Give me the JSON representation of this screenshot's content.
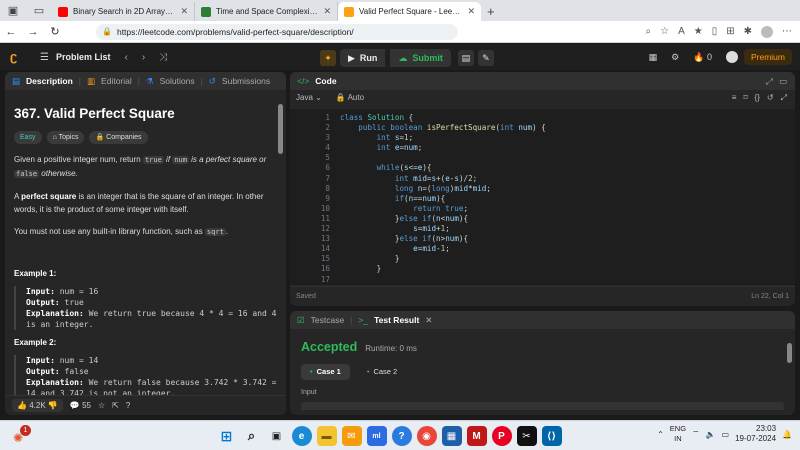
{
  "browser": {
    "tabs": [
      {
        "title": "Binary Search in 2D Arrays - You",
        "color": "#ff0000",
        "active": false
      },
      {
        "title": "Time and Space Complexity Anal",
        "color": "#2e7d32",
        "active": false
      },
      {
        "title": "Valid Perfect Square - LeetCode",
        "color": "#ffa116",
        "active": true
      }
    ],
    "url": "https://leetcode.com/problems/valid-perfect-square/description/"
  },
  "lcnav": {
    "problem_list": "Problem List",
    "run": "Run",
    "submit": "Submit",
    "streak": "0",
    "premium": "Premium"
  },
  "desc": {
    "tabs": [
      "Description",
      "Editorial",
      "Solutions",
      "Submissions"
    ],
    "title": "367. Valid Perfect Square",
    "tags": [
      "Easy",
      "Topics",
      "Companies"
    ],
    "p1_a": "Given a positive integer num, return ",
    "p1_true": "true",
    "p1_b": " if ",
    "p1_num": "num",
    "p1_c": " is a perfect square or",
    "p1_false": "false",
    "p1_d": " otherwise.",
    "p2_a": "A ",
    "p2_bold": "perfect square",
    "p2_b": " is an integer that is the square of an integer. In other words, it is the product of some integer with itself.",
    "p3_a": "You must not use any built-in library function, such as ",
    "p3_code": "sqrt",
    "p3_b": ".",
    "ex1_title": "Example 1:",
    "ex1_input_label": "Input:",
    "ex1_input": " num = 16",
    "ex1_output_label": "Output:",
    "ex1_output": " true",
    "ex1_expl_label": "Explanation:",
    "ex1_expl": " We return true because 4 * 4 = 16 and 4 is an integer.",
    "ex2_title": "Example 2:",
    "ex2_input_label": "Input:",
    "ex2_input": " num = 14",
    "ex2_output_label": "Output:",
    "ex2_output": " false",
    "ex2_expl_label": "Explanation:",
    "ex2_expl": " We return false because 3.742 * 3.742 = 14 and 3.742 is not an integer.",
    "likes": "4.2K",
    "comments": "55"
  },
  "code": {
    "tab": "Code",
    "language": "Java",
    "mode": "Auto",
    "status": "Saved",
    "cursor": "Ln 22, Col 1",
    "lines": [
      [
        [
          "kw",
          "class "
        ],
        [
          "ty",
          "Solution"
        ],
        [
          "pl",
          " {"
        ]
      ],
      [
        [
          "pl",
          "    "
        ],
        [
          "kw",
          "public boolean "
        ],
        [
          "fn",
          "isPerfectSquare"
        ],
        [
          "pl",
          "("
        ],
        [
          "kw",
          "int "
        ],
        [
          "tx",
          "num"
        ],
        [
          "pl",
          ") {"
        ]
      ],
      [
        [
          "pl",
          "        "
        ],
        [
          "kw",
          "int "
        ],
        [
          "tx",
          "s"
        ],
        [
          "pl",
          "="
        ],
        [
          "nu",
          "1"
        ],
        [
          "pl",
          ";"
        ]
      ],
      [
        [
          "pl",
          "        "
        ],
        [
          "kw",
          "int "
        ],
        [
          "tx",
          "e"
        ],
        [
          "pl",
          "="
        ],
        [
          "tx",
          "num"
        ],
        [
          "pl",
          ";"
        ]
      ],
      [
        [
          "pl",
          ""
        ]
      ],
      [
        [
          "pl",
          "        "
        ],
        [
          "kw",
          "while"
        ],
        [
          "pl",
          "("
        ],
        [
          "tx",
          "s"
        ],
        [
          "pl",
          "<="
        ],
        [
          "tx",
          "e"
        ],
        [
          "pl",
          "){"
        ]
      ],
      [
        [
          "pl",
          "            "
        ],
        [
          "kw",
          "int "
        ],
        [
          "tx",
          "mid"
        ],
        [
          "pl",
          "="
        ],
        [
          "tx",
          "s"
        ],
        [
          "pl",
          "+("
        ],
        [
          "tx",
          "e"
        ],
        [
          "pl",
          "-"
        ],
        [
          "tx",
          "s"
        ],
        [
          "pl",
          ")/"
        ],
        [
          "nu",
          "2"
        ],
        [
          "pl",
          ";"
        ]
      ],
      [
        [
          "pl",
          "            "
        ],
        [
          "kw",
          "long "
        ],
        [
          "tx",
          "n"
        ],
        [
          "pl",
          "=("
        ],
        [
          "kw",
          "long"
        ],
        [
          "pl",
          ")"
        ],
        [
          "tx",
          "mid"
        ],
        [
          "pl",
          "*"
        ],
        [
          "tx",
          "mid"
        ],
        [
          "pl",
          ";"
        ]
      ],
      [
        [
          "pl",
          "            "
        ],
        [
          "kw",
          "if"
        ],
        [
          "pl",
          "("
        ],
        [
          "tx",
          "n"
        ],
        [
          "pl",
          "=="
        ],
        [
          "tx",
          "num"
        ],
        [
          "pl",
          "){"
        ]
      ],
      [
        [
          "pl",
          "                "
        ],
        [
          "kw",
          "return true"
        ],
        [
          "pl",
          ";"
        ]
      ],
      [
        [
          "pl",
          "            }"
        ],
        [
          "kw",
          "else if"
        ],
        [
          "pl",
          "("
        ],
        [
          "tx",
          "n"
        ],
        [
          "pl",
          "<"
        ],
        [
          "tx",
          "num"
        ],
        [
          "pl",
          "){"
        ]
      ],
      [
        [
          "pl",
          "                "
        ],
        [
          "tx",
          "s"
        ],
        [
          "pl",
          "="
        ],
        [
          "tx",
          "mid"
        ],
        [
          "pl",
          "+"
        ],
        [
          "nu",
          "1"
        ],
        [
          "pl",
          ";"
        ]
      ],
      [
        [
          "pl",
          "            }"
        ],
        [
          "kw",
          "else if"
        ],
        [
          "pl",
          "("
        ],
        [
          "tx",
          "n"
        ],
        [
          "pl",
          ">"
        ],
        [
          "tx",
          "num"
        ],
        [
          "pl",
          "){"
        ]
      ],
      [
        [
          "pl",
          "                "
        ],
        [
          "tx",
          "e"
        ],
        [
          "pl",
          "="
        ],
        [
          "tx",
          "mid"
        ],
        [
          "pl",
          "-"
        ],
        [
          "nu",
          "1"
        ],
        [
          "pl",
          ";"
        ]
      ],
      [
        [
          "pl",
          "            }"
        ]
      ],
      [
        [
          "pl",
          "        }"
        ]
      ],
      [
        [
          "pl",
          ""
        ]
      ]
    ]
  },
  "test": {
    "tabs": [
      "Testcase",
      "Test Result"
    ],
    "result": "Accepted",
    "runtime": "Runtime: 0 ms",
    "cases": [
      "Case 1",
      "Case 2"
    ],
    "input_label": "Input"
  },
  "taskbar": {
    "lang1": "ENG",
    "lang2": "IN",
    "time": "23:03",
    "date": "19-07-2024",
    "badge": "1"
  }
}
